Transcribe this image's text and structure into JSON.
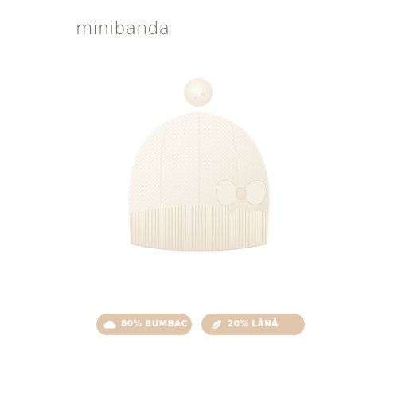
{
  "brand": {
    "logo_text": "minibanda"
  },
  "product": {
    "subject": "cream knit beanie with pom-pom and bow"
  },
  "badges": [
    {
      "icon": "cloud-icon",
      "label": "80% BUMBAC"
    },
    {
      "icon": "leaf-icon",
      "label": "20% LÂNĂ"
    }
  ],
  "colors": {
    "brand_text": "#6a5d55",
    "badge_bg": "#e0c7ac",
    "hat_cream": "#f8f3e9",
    "hat_shadow": "#e9e0d1"
  }
}
